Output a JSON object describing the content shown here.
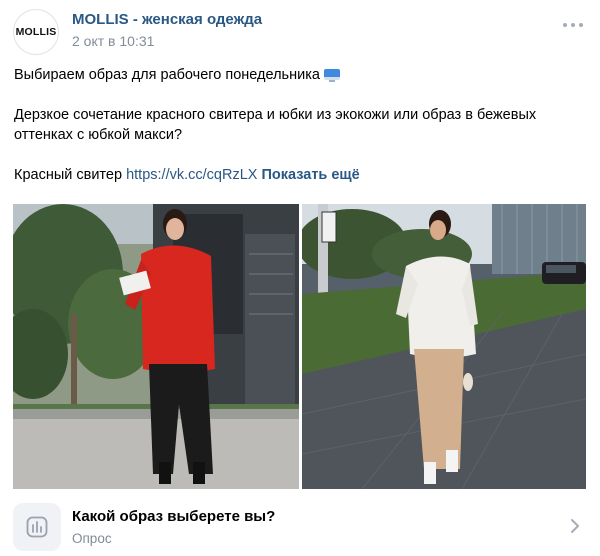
{
  "post": {
    "author": "MOLLIS - женская одежда",
    "avatar_text": "MOLLIS",
    "date": "2 окт в 10:31",
    "more_icon": "more-horizontal-icon",
    "text": {
      "line1": "Выбираем образ для рабочего понедельника",
      "line1_emoji_icon": "computer-monitor-icon",
      "line2": "Дерзкое сочетание красного свитера и юбки из экокожи или образ в бежевых оттенках с юбкой макси?",
      "line3_prefix": "Красный свитер ",
      "link": "https://vk.cc/cqRzLX",
      "show_more": "Показать ещё"
    },
    "photos": [
      {
        "icon": "photo-red-sweater"
      },
      {
        "icon": "photo-beige-outfit"
      }
    ],
    "poll": {
      "icon": "poll-chart-icon",
      "question": "Какой образ выберете вы?",
      "label": "Опрос",
      "chevron_icon": "chevron-right-icon"
    },
    "colors": {
      "link": "#2a5885",
      "secondary_text": "#818c99",
      "accent_sweater": "#d8271e"
    }
  }
}
